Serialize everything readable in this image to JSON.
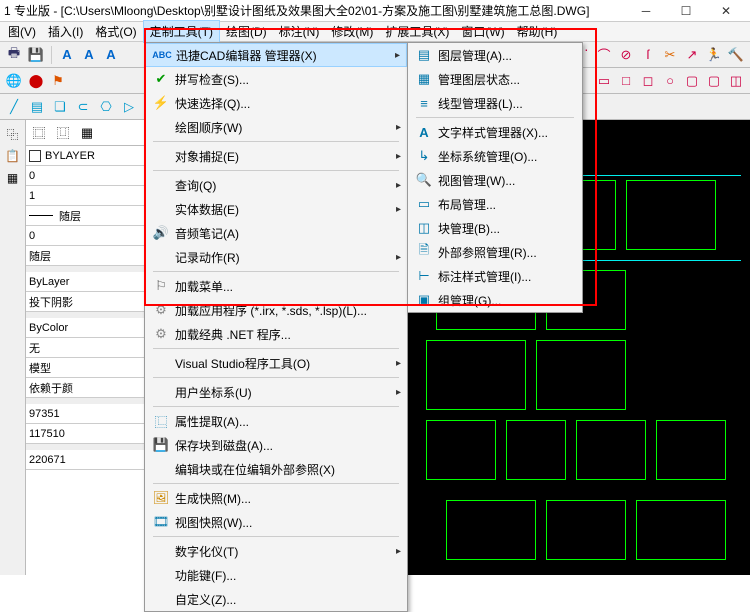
{
  "title": "1 专业版  - [C:\\Users\\Mloong\\Desktop\\别墅设计图纸及效果图大全02\\01-方案及施工图\\别墅建筑施工总图.DWG]",
  "menubar": {
    "left0": "图(V)",
    "left1": "插入(I)",
    "left2": "格式(O)",
    "m0": "定制工具(T)",
    "m1": "绘图(D)",
    "m2": "标注(N)",
    "m3": "修改(M)",
    "m4": "扩展工具(X)",
    "m5": "窗口(W)",
    "m6": "帮助(H)"
  },
  "dropdown": {
    "d0": "迅捷CAD编辑器 管理器(X)",
    "d1": "拼写检查(S)...",
    "d2": "快速选择(Q)...",
    "d3": "绘图顺序(W)",
    "d4": "对象捕捉(E)",
    "d5": "查询(Q)",
    "d6": "实体数据(E)",
    "d7": "音频笔记(A)",
    "d8": "记录动作(R)",
    "d9": "加载菜单...",
    "d10": "加载应用程序 (*.irx, *.sds, *.lsp)(L)...",
    "d11": "加载经典 .NET 程序...",
    "d12": "Visual Studio程序工具(O)",
    "d13": "用户坐标系(U)",
    "d14": "属性提取(A)...",
    "d15": "保存块到磁盘(A)...",
    "d16": "编辑块或在位编辑外部参照(X)",
    "d17": "生成快照(M)...",
    "d18": "视图快照(W)...",
    "d19": "数字化仪(T)",
    "d20": "功能键(F)...",
    "d21": "自定义(Z)..."
  },
  "submenu": {
    "s0": "图层管理(A)...",
    "s1": "管理图层状态...",
    "s2": "线型管理器(L)...",
    "s3": "文字样式管理器(X)...",
    "s4": "坐标系统管理(O)...",
    "s5": "视图管理(W)...",
    "s6": "布局管理...",
    "s7": "块管理(B)...",
    "s8": "外部参照管理(R)...",
    "s9": "标注样式管理(I)...",
    "s10": "组管理(G)..."
  },
  "props": {
    "p0": "BYLAYER",
    "p1": "0",
    "p2": "1",
    "p3": "随层",
    "p4": "0",
    "p5": "随层",
    "p6": "ByLayer",
    "p7": "投下阴影",
    "p8": "ByColor",
    "p9": "无",
    "p10": "模型",
    "p11": "依赖于颜",
    "p12": "97351",
    "p13": "117510",
    "p14": "220671"
  }
}
